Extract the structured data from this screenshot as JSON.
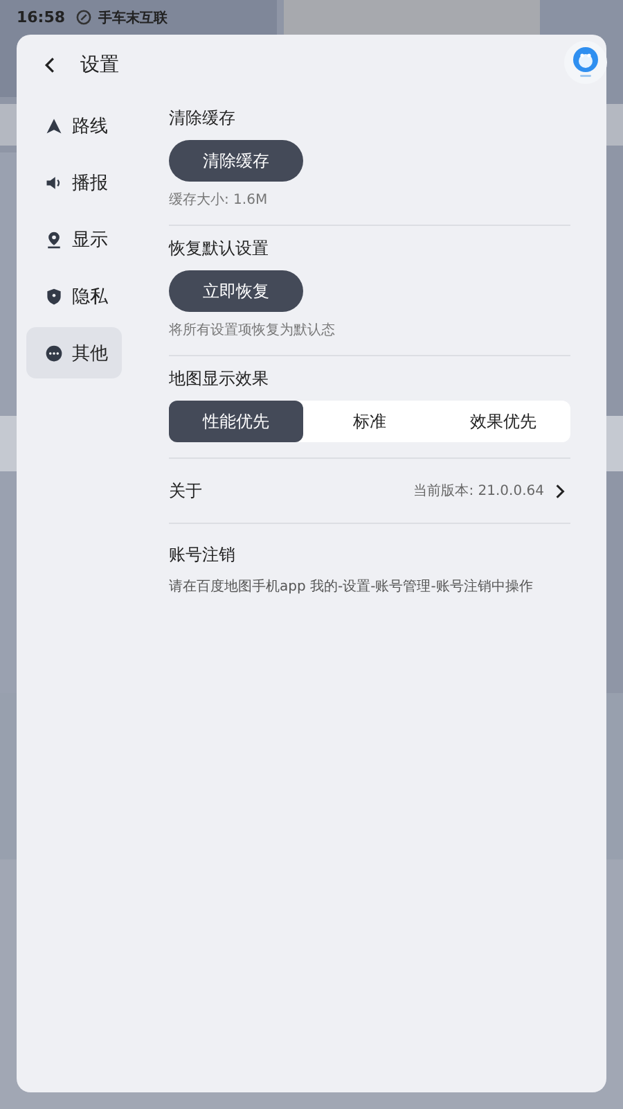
{
  "status_bar": {
    "time": "16:58",
    "network": "手车末互联"
  },
  "header": {
    "title": "设置"
  },
  "sidebar": {
    "items": [
      {
        "label": "路线",
        "selected": false
      },
      {
        "label": "播报",
        "selected": false
      },
      {
        "label": "显示",
        "selected": false
      },
      {
        "label": "隐私",
        "selected": false
      },
      {
        "label": "其他",
        "selected": true
      }
    ]
  },
  "clear_cache": {
    "title": "清除缓存",
    "button": "清除缓存",
    "note": "缓存大小: 1.6M"
  },
  "restore": {
    "title": "恢复默认设置",
    "button": "立即恢复",
    "note": "将所有设置项恢复为默认态"
  },
  "map_effect": {
    "title": "地图显示效果",
    "options": [
      {
        "label": "性能优先",
        "selected": true
      },
      {
        "label": "标准",
        "selected": false
      },
      {
        "label": "效果优先",
        "selected": false
      }
    ]
  },
  "about": {
    "label": "关于",
    "version": "当前版本: 21.0.0.64"
  },
  "account": {
    "title": "账号注销",
    "note": "请在百度地图手机app 我的-设置-账号管理-账号注销中操作"
  }
}
